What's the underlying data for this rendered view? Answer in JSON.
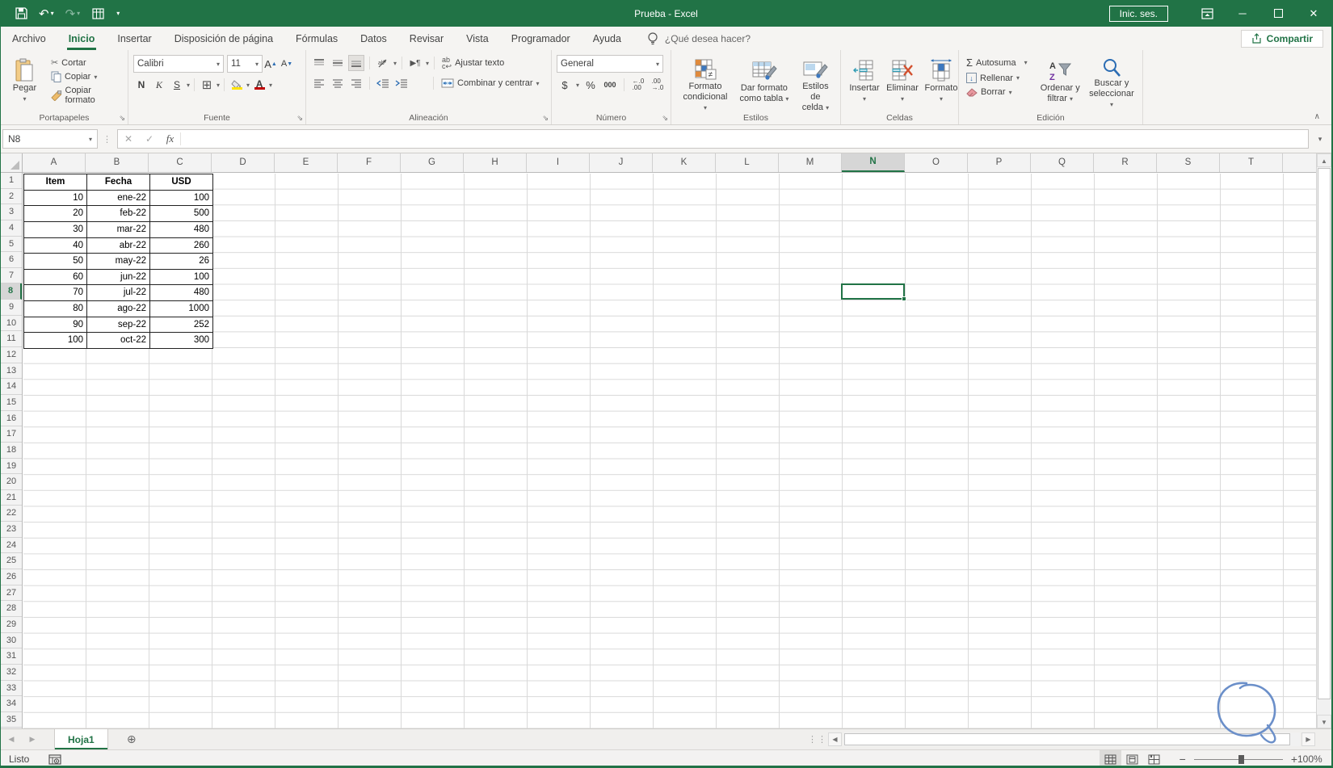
{
  "title_bar": {
    "title": "Prueba  -  Excel",
    "sign_in_label": "Inic. ses."
  },
  "menu": {
    "tabs": [
      {
        "label": "Archivo",
        "active": false
      },
      {
        "label": "Inicio",
        "active": true
      },
      {
        "label": "Insertar",
        "active": false
      },
      {
        "label": "Disposición de página",
        "active": false
      },
      {
        "label": "Fórmulas",
        "active": false
      },
      {
        "label": "Datos",
        "active": false
      },
      {
        "label": "Revisar",
        "active": false
      },
      {
        "label": "Vista",
        "active": false
      },
      {
        "label": "Programador",
        "active": false
      },
      {
        "label": "Ayuda",
        "active": false
      }
    ],
    "search_label": "¿Qué desea hacer?",
    "share_label": "Compartir"
  },
  "ribbon": {
    "clipboard": {
      "label": "Portapapeles",
      "paste": "Pegar",
      "cut": "Cortar",
      "copy": "Copiar",
      "format_painter": "Copiar formato"
    },
    "font": {
      "label": "Fuente",
      "font_name": "Calibri",
      "font_size": "11",
      "bold": "N",
      "italic": "K",
      "underline": "S"
    },
    "alignment": {
      "label": "Alineación",
      "wrap_text": "Ajustar texto",
      "merge_center": "Combinar y centrar"
    },
    "number": {
      "label": "Número",
      "format": "General",
      "currency": "$",
      "percent": "%",
      "thousands": "000"
    },
    "styles": {
      "label": "Estilos",
      "conditional_1": "Formato",
      "conditional_2": "condicional",
      "table_1": "Dar formato",
      "table_2": "como tabla",
      "cellstyles_1": "Estilos de",
      "cellstyles_2": "celda"
    },
    "cells": {
      "label": "Celdas",
      "insert": "Insertar",
      "delete": "Eliminar",
      "format": "Formato"
    },
    "editing": {
      "label": "Edición",
      "autosum": "Autosuma",
      "fill": "Rellenar",
      "clear": "Borrar",
      "sort_1": "Ordenar y",
      "sort_2": "filtrar",
      "find_1": "Buscar y",
      "find_2": "seleccionar"
    }
  },
  "formula_bar": {
    "name_box": "N8",
    "fx": "fx",
    "formula_value": ""
  },
  "grid": {
    "columns": [
      "A",
      "B",
      "C",
      "D",
      "E",
      "F",
      "G",
      "H",
      "I",
      "J",
      "K",
      "L",
      "M",
      "N",
      "O",
      "P",
      "Q",
      "R",
      "S",
      "T"
    ],
    "visible_rows": 35,
    "selected_cell": "N8",
    "selected_column": "N",
    "selected_row": 8
  },
  "table": {
    "headers": [
      "Item",
      "Fecha",
      "USD"
    ],
    "rows": [
      [
        "10",
        "ene-22",
        "100"
      ],
      [
        "20",
        "feb-22",
        "500"
      ],
      [
        "30",
        "mar-22",
        "480"
      ],
      [
        "40",
        "abr-22",
        "260"
      ],
      [
        "50",
        "may-22",
        "26"
      ],
      [
        "60",
        "jun-22",
        "100"
      ],
      [
        "70",
        "jul-22",
        "480"
      ],
      [
        "80",
        "ago-22",
        "1000"
      ],
      [
        "90",
        "sep-22",
        "252"
      ],
      [
        "100",
        "oct-22",
        "300"
      ]
    ]
  },
  "sheet_tabs": {
    "tabs": [
      {
        "label": "Hoja1",
        "active": true
      }
    ]
  },
  "status_bar": {
    "mode": "Listo",
    "zoom": "100%"
  },
  "colors": {
    "accent": "#217346",
    "fill_yellow": "#ffe400",
    "font_red": "#c00000",
    "annotation_blue": "#6b8fc9"
  }
}
